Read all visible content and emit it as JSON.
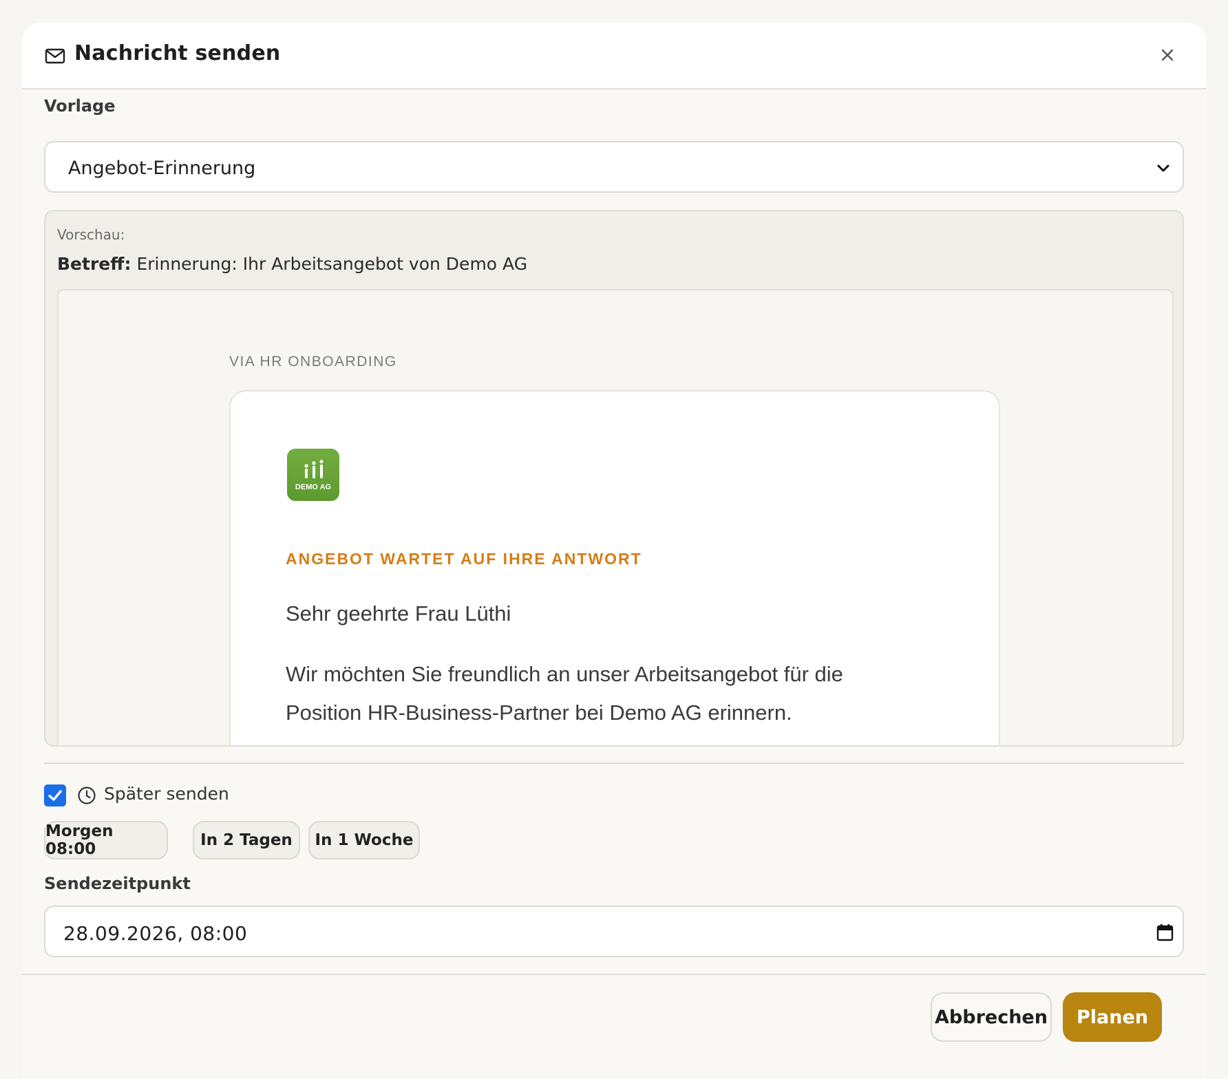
{
  "dialog": {
    "title": "Nachricht senden",
    "icons": {
      "title_icon": "mail-icon",
      "close": "close-icon"
    }
  },
  "template": {
    "label": "Vorlage",
    "selected": "Angebot-Erinnerung"
  },
  "preview": {
    "label": "Vorschau:",
    "subject_label": "Betreff:",
    "subject": "Erinnerung: Ihr Arbeitsangebot von Demo AG",
    "email": {
      "via": "VIA HR ONBOARDING",
      "logo_text": "DEMO AG",
      "eyebrow": "ANGEBOT WARTET AUF IHRE ANTWORT",
      "greeting": "Sehr geehrte Frau Lüthi",
      "body": "Wir möchten Sie freundlich an unser Arbeitsangebot für die Position HR-Business-Partner bei Demo AG erinnern."
    }
  },
  "schedule": {
    "later_label": "Später senden",
    "later_checked": true,
    "chips": [
      "Morgen 08:00",
      "In 2 Tagen",
      "In 1 Woche"
    ],
    "datetime_label": "Sendezeitpunkt",
    "datetime_value": "28.09.2026, 08:00"
  },
  "footer": {
    "cancel": "Abbrechen",
    "submit": "Planen"
  },
  "colors": {
    "accent": "#b8860f",
    "eyebrow": "#d57d16",
    "checkbox": "#1a6ee8",
    "logo_green": "#5c9a2f"
  }
}
